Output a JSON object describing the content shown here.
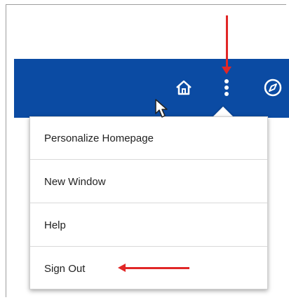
{
  "header": {
    "bg_color": "#0b4ba3",
    "icons": [
      "home-icon",
      "more-vertical-icon",
      "compass-icon"
    ]
  },
  "menu": {
    "items": [
      {
        "label": "Personalize Homepage"
      },
      {
        "label": "New Window"
      },
      {
        "label": "Help"
      },
      {
        "label": "Sign Out"
      }
    ]
  },
  "annotations": {
    "arrow_color": "#e12727"
  }
}
